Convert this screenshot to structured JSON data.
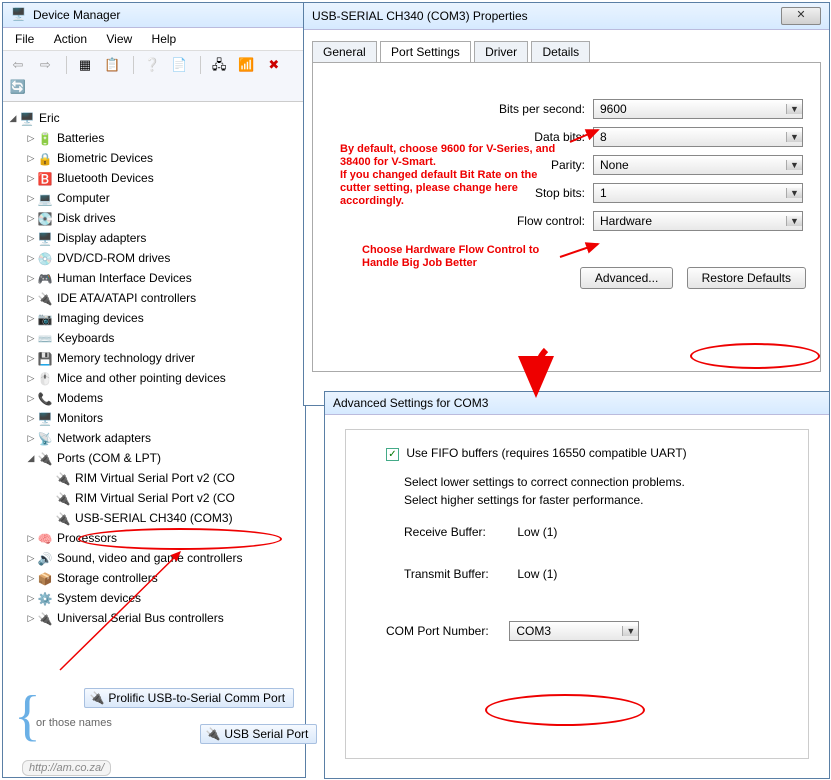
{
  "devmgr": {
    "title": "Device Manager",
    "menu": [
      "File",
      "Action",
      "View",
      "Help"
    ],
    "root": "Eric",
    "nodes": [
      "Batteries",
      "Biometric Devices",
      "Bluetooth Devices",
      "Computer",
      "Disk drives",
      "Display adapters",
      "DVD/CD-ROM drives",
      "Human Interface Devices",
      "IDE ATA/ATAPI controllers",
      "Imaging devices",
      "Keyboards",
      "Memory technology driver",
      "Mice and other pointing devices",
      "Modems",
      "Monitors",
      "Network adapters",
      "Ports (COM & LPT)",
      "Processors",
      "Sound, video and game controllers",
      "Storage controllers",
      "System devices",
      "Universal Serial Bus controllers"
    ],
    "port_children": [
      "RIM Virtual Serial Port v2 (CO",
      "RIM Virtual Serial Port v2 (CO",
      "USB-SERIAL CH340 (COM3)"
    ],
    "alt_names": {
      "or": "or those names",
      "pill1": "Prolific USB-to-Serial Comm Port",
      "pill2": "USB Serial Port"
    }
  },
  "props": {
    "title": "USB-SERIAL CH340 (COM3) Properties",
    "tabs": [
      "General",
      "Port Settings",
      "Driver",
      "Details"
    ],
    "fields": {
      "bits_label": "Bits per second:",
      "bits_val": "9600",
      "data_label": "Data bits:",
      "data_val": "8",
      "parity_label": "Parity:",
      "parity_val": "None",
      "stop_label": "Stop bits:",
      "stop_val": "1",
      "flow_label": "Flow control:",
      "flow_val": "Hardware"
    },
    "advanced_btn": "Advanced...",
    "restore_btn": "Restore Defaults"
  },
  "adv": {
    "title": "Advanced Settings for COM3",
    "fifo_label": "Use FIFO buffers (requires 16550 compatible UART)",
    "line1": "Select lower settings to correct connection problems.",
    "line2": "Select higher settings for faster performance.",
    "recv_label": "Receive Buffer:",
    "recv_low": "Low (1)",
    "tx_label": "Transmit Buffer:",
    "tx_low": "Low (1)",
    "com_label": "COM Port Number:",
    "com_val": "COM3"
  },
  "ann": {
    "bits_note": "By default, choose 9600 for V-Series, and 38400 for V-Smart.\nIf you changed default Bit Rate on the cutter setting, please change here accordingly.",
    "flow_note": "Choose Hardware Flow Control to Handle Big Job Better"
  },
  "url": "http://am.co.za/"
}
